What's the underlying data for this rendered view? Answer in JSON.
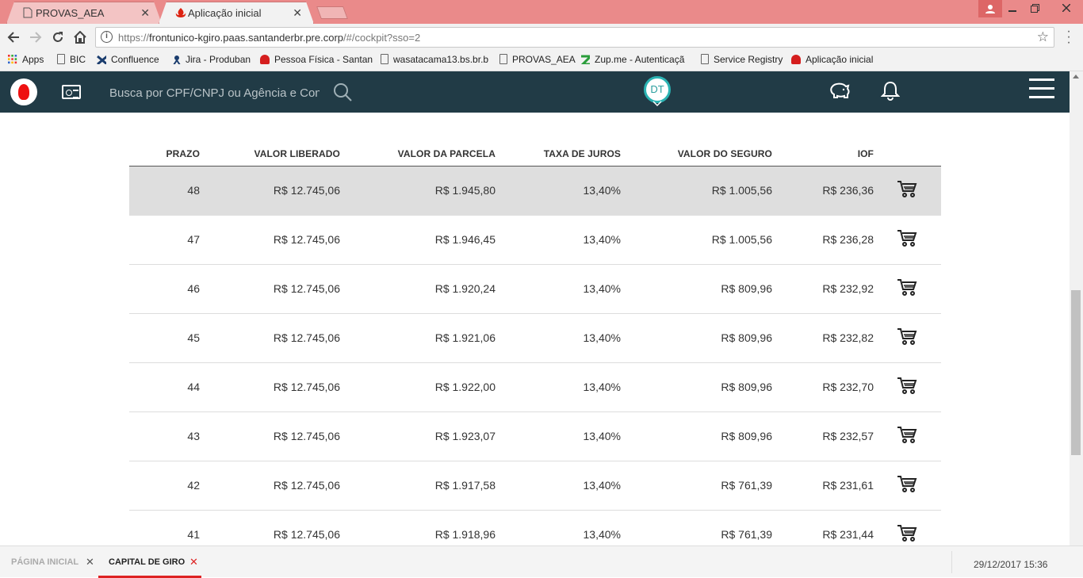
{
  "browser": {
    "tabs": [
      {
        "title": "PROVAS_AEA",
        "active": false,
        "close": "✕"
      },
      {
        "title": "Aplicação inicial",
        "active": true,
        "close": "✕"
      }
    ],
    "url_prefix": "https://",
    "url_main": "frontunico-kgiro.paas.santanderbr.pre.corp",
    "url_rest": "/#/cockpit?sso=2",
    "bookmarks": [
      {
        "label": "Apps",
        "icon": "apps-grid-icon"
      },
      {
        "label": "BIC",
        "icon": "page-icon"
      },
      {
        "label": "Confluence",
        "icon": "confluence-icon"
      },
      {
        "label": "Jira - Produban",
        "icon": "jira-icon"
      },
      {
        "label": "Pessoa Física - Santan",
        "icon": "santander-icon"
      },
      {
        "label": "wasatacama13.bs.br.b",
        "icon": "page-icon"
      },
      {
        "label": "PROVAS_AEA",
        "icon": "page-icon"
      },
      {
        "label": "Zup.me - Autenticaçã",
        "icon": "zup-icon"
      },
      {
        "label": "Service Registry",
        "icon": "page-icon"
      },
      {
        "label": "Aplicação inicial",
        "icon": "santander-icon"
      }
    ]
  },
  "header": {
    "search_placeholder": "Busca por CPF/CNPJ ou Agência e Conta",
    "avatar_initials": "DT"
  },
  "table": {
    "columns": [
      "PRAZO",
      "VALOR LIBERADO",
      "VALOR DA PARCELA",
      "TAXA DE JUROS",
      "VALOR DO SEGURO",
      "IOF"
    ],
    "rows": [
      {
        "prazo": "48",
        "liberado": "R$ 12.745,06",
        "parcela": "R$ 1.945,80",
        "taxa": "13,40%",
        "seguro": "R$ 1.005,56",
        "iof": "R$ 236,36",
        "selected": true
      },
      {
        "prazo": "47",
        "liberado": "R$ 12.745,06",
        "parcela": "R$ 1.946,45",
        "taxa": "13,40%",
        "seguro": "R$ 1.005,56",
        "iof": "R$ 236,28"
      },
      {
        "prazo": "46",
        "liberado": "R$ 12.745,06",
        "parcela": "R$ 1.920,24",
        "taxa": "13,40%",
        "seguro": "R$ 809,96",
        "iof": "R$ 232,92"
      },
      {
        "prazo": "45",
        "liberado": "R$ 12.745,06",
        "parcela": "R$ 1.921,06",
        "taxa": "13,40%",
        "seguro": "R$ 809,96",
        "iof": "R$ 232,82"
      },
      {
        "prazo": "44",
        "liberado": "R$ 12.745,06",
        "parcela": "R$ 1.922,00",
        "taxa": "13,40%",
        "seguro": "R$ 809,96",
        "iof": "R$ 232,70"
      },
      {
        "prazo": "43",
        "liberado": "R$ 12.745,06",
        "parcela": "R$ 1.923,07",
        "taxa": "13,40%",
        "seguro": "R$ 809,96",
        "iof": "R$ 232,57"
      },
      {
        "prazo": "42",
        "liberado": "R$ 12.745,06",
        "parcela": "R$ 1.917,58",
        "taxa": "13,40%",
        "seguro": "R$ 761,39",
        "iof": "R$ 231,61"
      },
      {
        "prazo": "41",
        "liberado": "R$ 12.745,06",
        "parcela": "R$ 1.918,96",
        "taxa": "13,40%",
        "seguro": "R$ 761,39",
        "iof": "R$ 231,44"
      }
    ]
  },
  "footer": {
    "tabs": [
      {
        "label": "PÁGINA INICIAL",
        "active": false
      },
      {
        "label": "CAPITAL DE GIRO",
        "active": true
      }
    ],
    "close": "✕",
    "datetime": "29/12/2017 15:36"
  },
  "colors": {
    "header_bg": "#213b46",
    "brand_red": "#ec0000",
    "tabstrip": "#ea8a8a",
    "avatar_ring": "#2bb3b3"
  }
}
